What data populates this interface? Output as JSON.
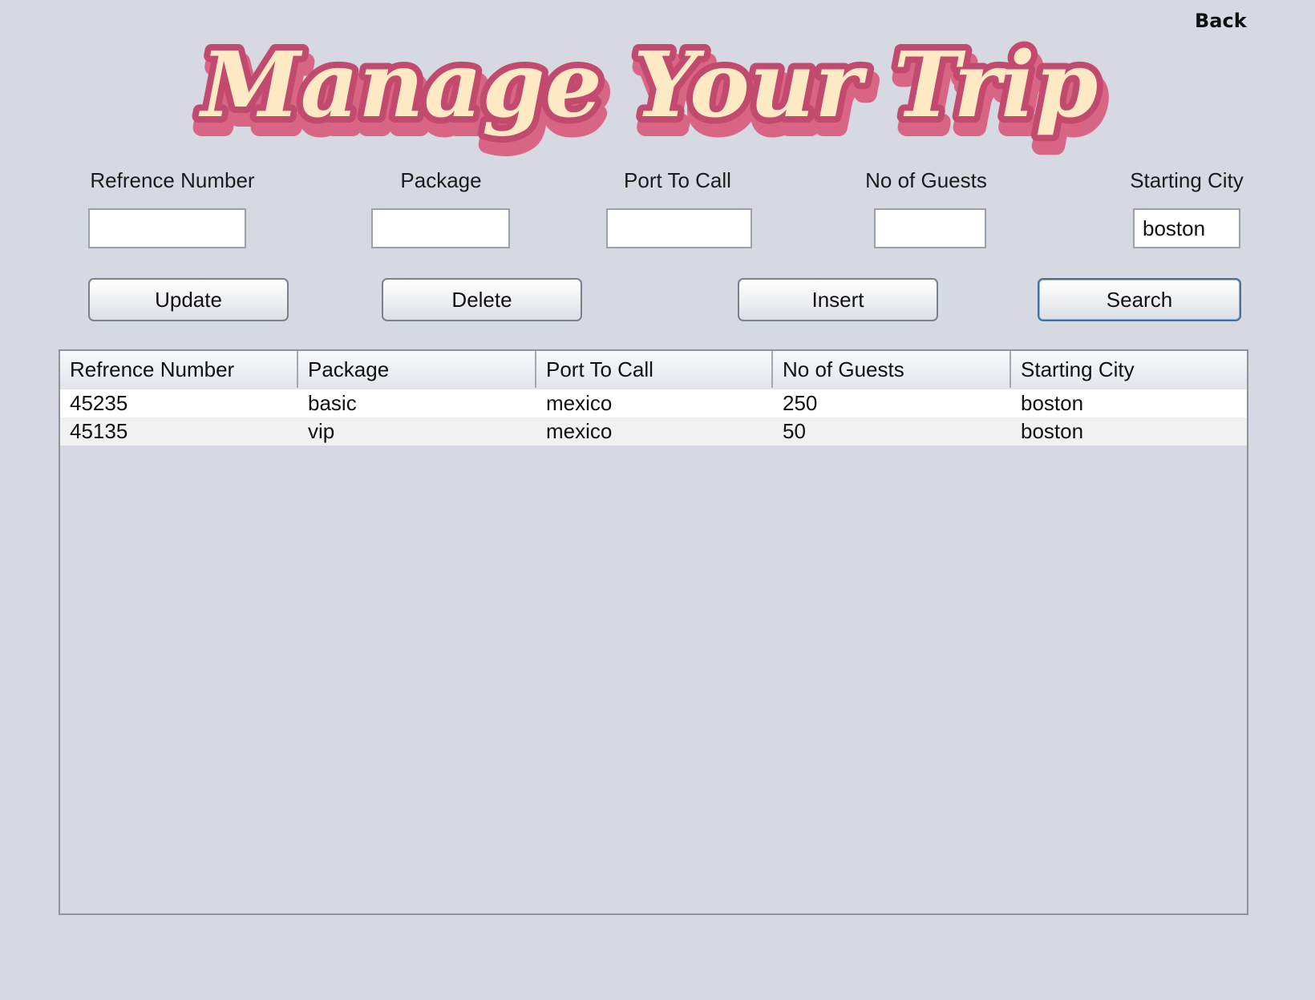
{
  "header": {
    "back_label": "Back",
    "title": "Manage Your Trip"
  },
  "form": {
    "fields": [
      {
        "label": "Refrence Number",
        "value": ""
      },
      {
        "label": "Package",
        "value": ""
      },
      {
        "label": "Port To Call",
        "value": ""
      },
      {
        "label": "No of Guests",
        "value": ""
      },
      {
        "label": "Starting City",
        "value": "boston"
      }
    ]
  },
  "actions": {
    "update_label": "Update",
    "delete_label": "Delete",
    "insert_label": "Insert",
    "search_label": "Search"
  },
  "table": {
    "columns": [
      "Refrence Number",
      "Package",
      "Port To Call",
      "No of Guests",
      "Starting City"
    ],
    "rows": [
      [
        "45235",
        "basic",
        "mexico",
        "250",
        "boston"
      ],
      [
        "45135",
        "vip",
        "mexico",
        "50",
        "boston"
      ]
    ]
  },
  "colors": {
    "background": "#d6d9e1",
    "title_fill": "#fde9c4",
    "title_outline": "#c24a6e",
    "title_shadow": "#e07890"
  }
}
